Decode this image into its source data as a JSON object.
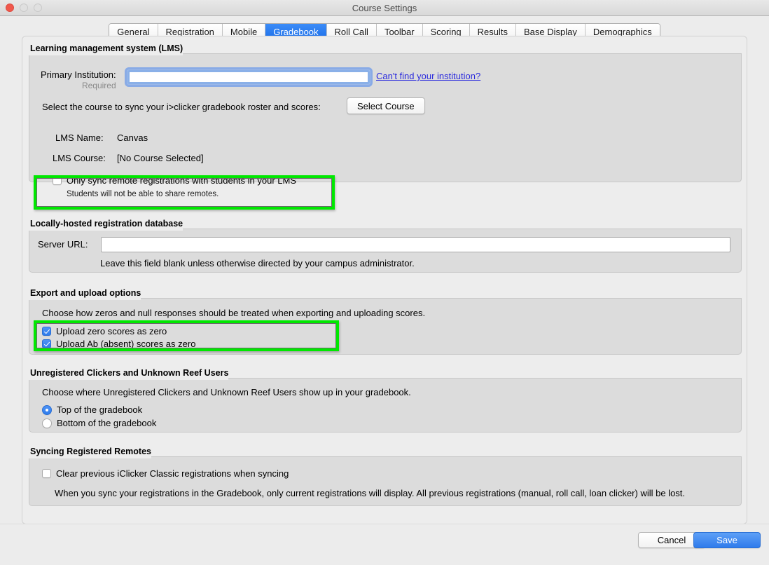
{
  "window": {
    "title": "Course Settings",
    "traffic_lights": [
      "close",
      "minimize",
      "maximize"
    ]
  },
  "tabs": [
    {
      "label": "General",
      "selected": false
    },
    {
      "label": "Registration",
      "selected": false
    },
    {
      "label": "Mobile",
      "selected": false
    },
    {
      "label": "Gradebook",
      "selected": true
    },
    {
      "label": "Roll Call",
      "selected": false
    },
    {
      "label": "Toolbar",
      "selected": false
    },
    {
      "label": "Scoring",
      "selected": false
    },
    {
      "label": "Results",
      "selected": false
    },
    {
      "label": "Base Display",
      "selected": false
    },
    {
      "label": "Demographics",
      "selected": false
    }
  ],
  "lms": {
    "group_title": "Learning management system (LMS)",
    "primary_institution_label": "Primary Institution:",
    "primary_institution_required": "Required",
    "primary_institution_value": "",
    "cant_find_link": "Can't find your institution?",
    "select_course_text": "Select the course to sync your i>clicker gradebook roster and scores:",
    "select_course_button": "Select Course",
    "lms_name_label": "LMS Name:",
    "lms_name_value": "Canvas",
    "lms_course_label": "LMS Course:",
    "lms_course_value": "[No Course Selected]",
    "only_sync_label": "Only sync remote registrations with students in your LMS",
    "only_sync_checked": false,
    "only_sync_note": "Students will not be able to share remotes."
  },
  "local_db": {
    "group_title": "Locally-hosted registration database",
    "server_url_label": "Server URL:",
    "server_url_value": "",
    "note": "Leave this field blank unless otherwise directed by your campus administrator."
  },
  "export": {
    "group_title": "Export and upload options",
    "description": "Choose how zeros and null responses should be treated when exporting and uploading scores.",
    "upload_zero_label": "Upload zero scores as zero",
    "upload_zero_checked": true,
    "upload_ab_label": "Upload Ab (absent) scores as zero",
    "upload_ab_checked": true
  },
  "unregistered": {
    "group_title": "Unregistered Clickers and Unknown Reef Users",
    "description": "Choose where Unregistered Clickers and Unknown Reef Users show up in your gradebook.",
    "options": [
      {
        "label": "Top of the gradebook",
        "selected": true
      },
      {
        "label": "Bottom of the gradebook",
        "selected": false
      }
    ]
  },
  "syncing": {
    "group_title": "Syncing Registered Remotes",
    "clear_label": "Clear previous iClicker Classic registrations when syncing",
    "clear_checked": false,
    "note": "When you sync your registrations in the Gradebook, only current registrations will display. All previous registrations (manual, roll call, loan clicker) will be lost."
  },
  "footer": {
    "cancel_label": "Cancel",
    "save_label": "Save"
  },
  "colors": {
    "accent_blue": "#2f7beb",
    "highlight_green": "#00e800",
    "link_blue": "#2b2bdd",
    "window_bg": "#ececec",
    "panel_bg": "#dcdcdc"
  }
}
